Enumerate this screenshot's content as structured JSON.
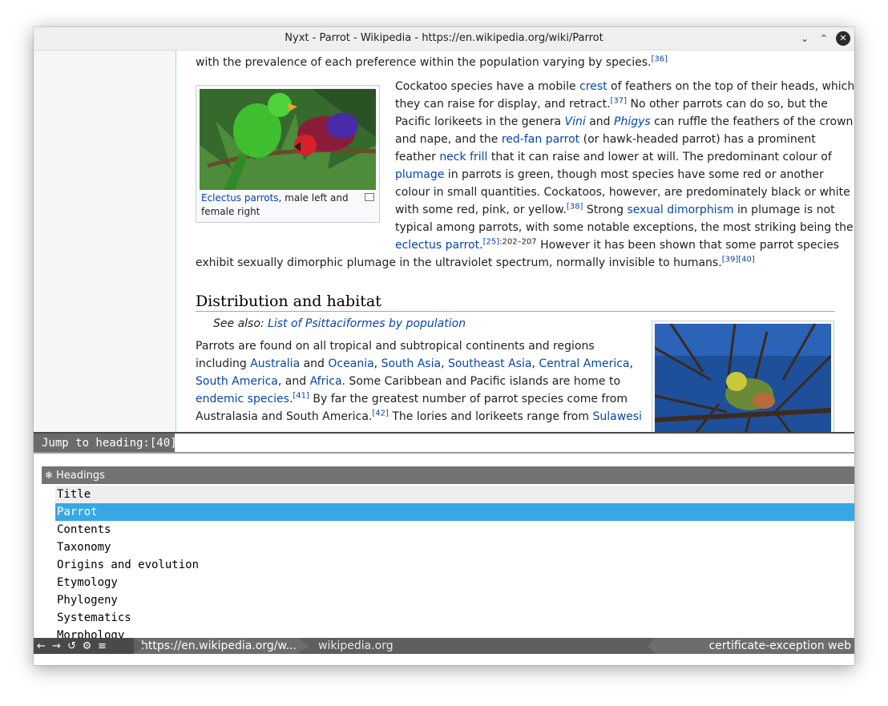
{
  "window": {
    "title": "Nyxt - Parrot - Wikipedia - https://en.wikipedia.org/wiki/Parrot",
    "icons": {
      "minimize": "chevron-down-icon",
      "maximize": "chevron-up-icon",
      "close": "close-icon"
    }
  },
  "article": {
    "line0": "with the prevalence of each preference within the population varying by species.",
    "ref36": "[36]",
    "p1": {
      "l1a": "Cockatoo species have a mobile ",
      "l1link": "crest",
      "l1b": " of feathers on the top of their heads, which",
      "l2a": "they can raise for display, and retract.",
      "l2ref": "[37]",
      "l2b": " No other parrots can do so, but the",
      "l3a": "Pacific lorikeets in the genera ",
      "l3link1": "Vini",
      "l3mid": " and ",
      "l3link2": "Phigys",
      "l3b": " can ruffle the feathers of the crown",
      "l4a": "and nape, and the ",
      "l4link": "red-fan parrot",
      "l4b": " (or hawk-headed parrot) has a prominent",
      "l5a": "feather ",
      "l5link": "neck frill",
      "l5b": " that it can raise and lower at will. The predominant colour of",
      "l6link": "plumage",
      "l6b": " in parrots is green, though most species have some red or another",
      "l7": "colour in small quantities. Cockatoos, however, are predominately black or white",
      "l8a": "with some red, pink, or yellow.",
      "l8ref": "[38]",
      "l8b": " Strong ",
      "l8link": "sexual dimorphism",
      "l8c": " in plumage is not",
      "l9": "typical among parrots, with some notable exceptions, the most striking being the",
      "l10link": "eclectus parrot",
      "l10dot": ".",
      "l10ref": "[25]",
      "l10pages": ":202–207",
      "l10b": " However it has been shown that some parrot species",
      "l11": "exhibit sexually dimorphic plumage in the ultraviolet spectrum, normally invisible to humans.",
      "l11refs": "[39][40]"
    },
    "thumb1": {
      "caption_link": "Eclectus parrots",
      "caption_rest": ", male left and female right"
    },
    "section_heading": "Distribution and habitat",
    "see_also_label": "See also: ",
    "see_also_link": "List of Psittaciformes by population",
    "p2": {
      "l1": "Parrots are found on all tropical and subtropical continents and regions",
      "l2a": "including ",
      "l2link1": "Australia",
      "l2b": " and ",
      "l2link2": "Oceania",
      "l2c": ", ",
      "l2link3": "South Asia",
      "l2d": ", ",
      "l2link4": "Southeast Asia",
      "l2e": ", ",
      "l2link5": "Central America",
      "l2f": ",",
      "l3link1": "South America",
      "l3a": ", and ",
      "l3link2": "Africa",
      "l3b": ". Some Caribbean and Pacific islands are home to",
      "l4link": "endemic species",
      "l4dot": ".",
      "l4ref": "[41]",
      "l4b": " By far the greatest number of parrot species come from",
      "l5a": "Australasia and South America.",
      "l5ref": "[42]",
      "l5b": " The lories and lorikeets range from ",
      "l5link": "Sulawesi"
    }
  },
  "prompt": {
    "label": "Jump to heading:[40]",
    "input_value": ""
  },
  "suggestions": {
    "source_name": "Headings",
    "source_icon": "snowflake-icon",
    "header": "Title",
    "selected_index": 0,
    "items": [
      "Parrot",
      "Contents",
      "Taxonomy",
      "Origins and evolution",
      "Etymology",
      "Phylogeny",
      "Systematics",
      "Morphology"
    ]
  },
  "statusbar": {
    "buttons": [
      "←",
      "→",
      "↺",
      "⚙",
      "≡"
    ],
    "button_icons": [
      "back-arrow-icon",
      "forward-arrow-icon",
      "reload-icon",
      "gear-icon",
      "menu-icon"
    ],
    "url": "https://en.wikipedia.org/w...",
    "domain": "wikipedia.org",
    "modes": "certificate-exception web"
  },
  "colors": {
    "link": "#0645ad",
    "selection": "#37a8e4",
    "statusbar": "#5f5f5f",
    "prompt_label": "#6b6b6b"
  }
}
